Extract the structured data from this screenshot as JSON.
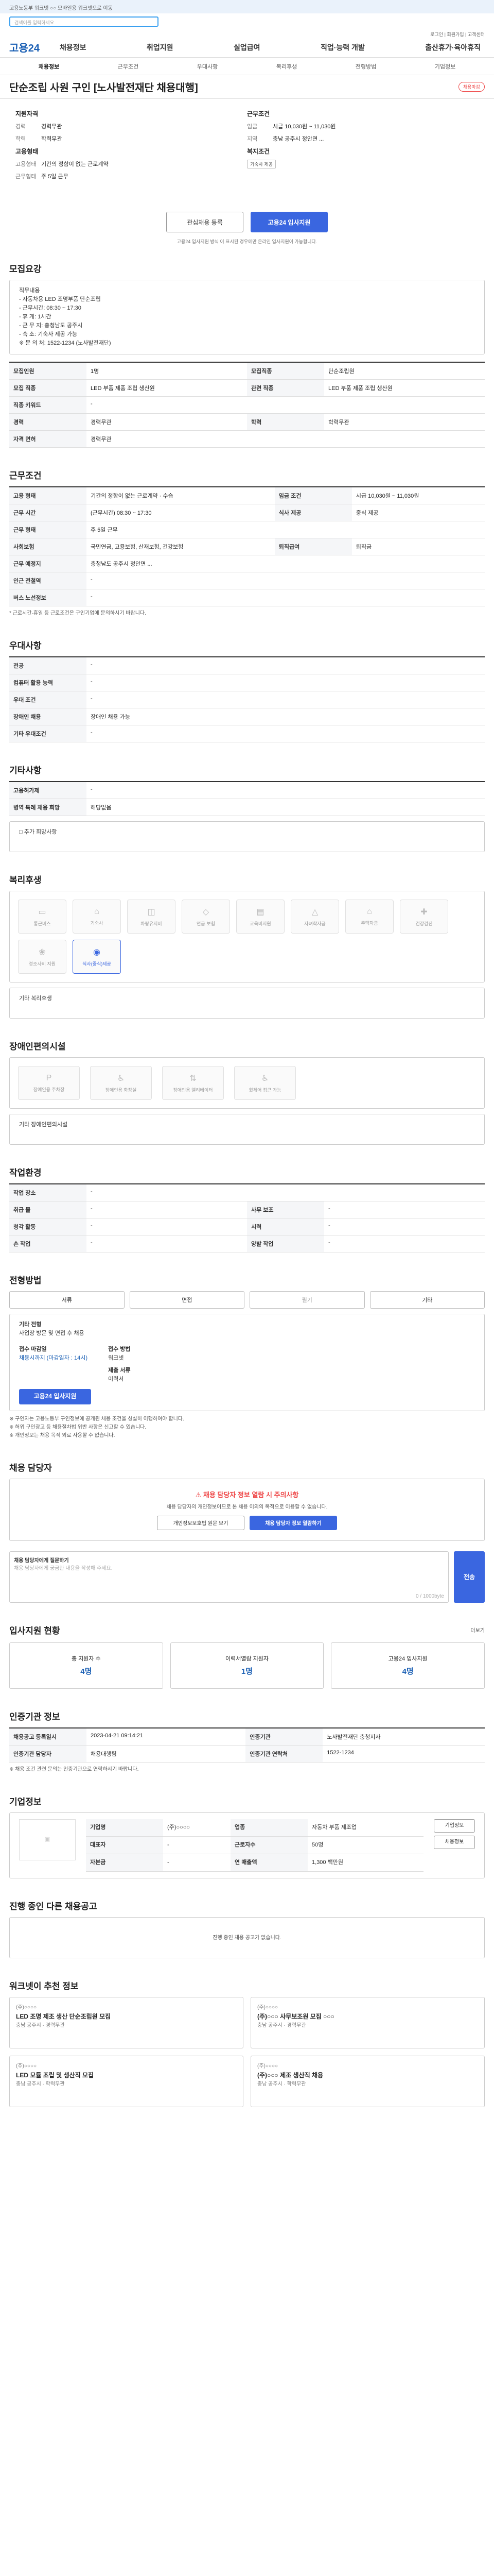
{
  "topbar": {
    "text": "고용노동부 워크넷 ○○ 모바일용 워크넷으로 이동"
  },
  "search": {
    "placeholder": "검색어를 입력하세요",
    "button": "검색"
  },
  "util": {
    "text": "로그인 | 회원가입 | 고객센터"
  },
  "header": {
    "logo": "고용24",
    "menu": [
      "채용정보",
      "취업지원",
      "실업급여",
      "직업·능력 개발",
      "출산휴가·육아휴직"
    ]
  },
  "tabs": [
    "채용정보",
    "근무조건",
    "우대사항",
    "복리후생",
    "전형방법",
    "기업정보"
  ],
  "title": {
    "text": "단순조립 사원 구인 [노사발전재단 채용대행]",
    "badge": "채용마감"
  },
  "summary": {
    "left_title": "지원자격",
    "left": [
      {
        "k": "경력",
        "v": "경력무관"
      },
      {
        "k": "학력",
        "v": "학력무관"
      }
    ],
    "left_title2": "고용형태",
    "left2": [
      {
        "k": "고용형태",
        "v": "기간의 정함이 없는 근로계약"
      },
      {
        "k": "근무형태",
        "v": "주 5일 근무"
      }
    ],
    "right_title": "근무조건",
    "right": [
      {
        "k": "임금",
        "v": "시급 10,030원 ~ 11,030원"
      },
      {
        "k": "지역",
        "v": "충남 공주시 정안면 ..."
      }
    ],
    "right_title2": "복지조건",
    "right2": "기숙사 제공"
  },
  "buttons": {
    "interest": "관심채용 등록",
    "apply": "고용24 입사지원"
  },
  "apply_note": "고용24 입사지원 방식 이 표시된 경우에만 온라인 입사지원이 가능합니다.",
  "s1": {
    "title": "모집요강",
    "box": [
      "직무내용",
      "- 자동차용 LED 조명부품 단순조립",
      "- 근무시간: 08:30 ~ 17:30",
      "- 휴 게: 1시간",
      "- 근 무 지: 충청남도 공주시",
      "- 숙 소: 기숙사 제공 가능",
      "",
      "※ 문 의 처: 1522-1234 (노사발전재단)"
    ],
    "rows": [
      [
        "모집인원",
        "1명",
        "모집직종",
        "단순조립원"
      ],
      [
        "모집 직종",
        "LED 부품 제품 조립 생산원",
        "관련 직종",
        "LED 부품 제품 조립 생산원"
      ],
      [
        "직종 키워드",
        "-",
        "",
        ""
      ],
      [
        "경력",
        "경력무관",
        "학력",
        "학력무관"
      ],
      [
        "자격 면허",
        "경력무관",
        "",
        ""
      ]
    ]
  },
  "s2": {
    "title": "근무조건",
    "rows": [
      [
        "고용 형태",
        "기간의 정함이 없는 근로계약 · 수습",
        "임금 조건",
        "시급 10,030원 ~ 11,030원"
      ],
      [
        "근무 시간",
        "(근무시간) 08:30 ~ 17:30",
        "식사 제공",
        "중식 제공"
      ],
      [
        "근무 형태",
        "주 5일 근무",
        "",
        ""
      ],
      [
        "사회보험",
        "국민연금, 고용보험, 산재보험, 건강보험",
        "퇴직급여",
        "퇴직금"
      ],
      [
        "근무 예정지",
        "충청남도 공주시 정안면 ...",
        "",
        ""
      ],
      [
        "인근 전철역",
        "-",
        "",
        ""
      ],
      [
        "버스 노선정보",
        "-",
        "",
        ""
      ]
    ],
    "note": "* 근로시간·휴일 등 근로조건은 구인기업에 문의하시기 바랍니다."
  },
  "s3": {
    "title": "우대사항",
    "rows": [
      [
        "전공",
        "-"
      ],
      [
        "컴퓨터 활용 능력",
        "-"
      ],
      [
        "우대 조건",
        "-"
      ],
      [
        "장애인 채용",
        "장애인 채용 가능"
      ],
      [
        "기타 우대조건",
        "-"
      ]
    ]
  },
  "s4": {
    "title": "기타사항",
    "rows": [
      [
        "고용허가제",
        "-"
      ],
      [
        "병역 특례 채용 희망",
        "해당없음"
      ]
    ],
    "box": "□ 추가 희망사항"
  },
  "s5": {
    "title": "복리후생",
    "items": [
      "통근버스",
      "기숙사",
      "차량유지비",
      "연금·보험",
      "교육비지원",
      "자녀학자금",
      "주택자금",
      "건강검진",
      "경조사비 지원",
      "식사(중식)제공"
    ],
    "other": "기타 복리후생"
  },
  "s6": {
    "title": "장애인편의시설",
    "items": [
      "장애인용 주차장",
      "장애인용 화장실",
      "장애인용 엘리베이터",
      "휠체어 접근 가능"
    ],
    "other": "기타 장애인편의시설"
  },
  "s7": {
    "title": "작업환경",
    "rows": [
      [
        "작업 장소",
        "-",
        "",
        ""
      ],
      [
        "취급 물",
        "-",
        "사무 보조",
        "-"
      ],
      [
        "청각 활동",
        "-",
        "시력",
        "-"
      ],
      [
        "손 작업",
        "-",
        "양발 작업",
        "-"
      ]
    ]
  },
  "s8": {
    "title": "전형방법",
    "choices": [
      "서류",
      "면접",
      "필기",
      "기타"
    ],
    "other_label": "기타 전형",
    "other": "사업장 방문 및 면접 후 채용",
    "deadline_label": "접수 마감일",
    "deadline": "채용시까지 (마감일자 : 14시)",
    "method_label": "접수 방법",
    "method": "워크넷",
    "docs_label": "제출 서류",
    "docs": "이력서",
    "apply": "고용24 입사지원",
    "notes": [
      "※ 구인자는 고용노동부 구인정보에 공개된 채용 조건을 성실히 이행하여야 합니다.",
      "※ 허위 구인광고 등 채용절차법 위반 사항은 신고할 수 있습니다.",
      "※ 개인정보는 채용 목적 외로 사용할 수 없습니다."
    ]
  },
  "s9": {
    "title": "채용 담당자",
    "alert": "채용 담당자 정보 열람 시 주의사항",
    "alert_text": "채용 담당자의 개인정보이므로 본 채용 이외의 목적으로 이용할 수 없습니다.",
    "btn1": "개인정보보호법 원문 보기",
    "btn2": "채용 담당자 정보 열람하기",
    "msg_label": "채용 담당자에게 질문하기",
    "msg_placeholder": "채용 담당자에게 궁금한 내용을 작성해 주세요.",
    "msg_count": "0 / 1000byte",
    "send": "전송"
  },
  "s10": {
    "title": "입사지원 현황",
    "more": "더보기",
    "stats": [
      [
        "총 지원자 수",
        "4명"
      ],
      [
        "이력서열람 지원자",
        "1명"
      ],
      [
        "고용24 입사지원",
        "4명"
      ]
    ]
  },
  "s11": {
    "title": "인증기관 정보",
    "rows": [
      [
        "채용공고 등록일시",
        "2023-04-21 09:14:21",
        "인증기관",
        "노사발전재단 충청지사"
      ],
      [
        "인증기관 담당자",
        "채용대행팀",
        "인증기관 연락처",
        "1522-1234"
      ]
    ],
    "notes": [
      "※ 채용 조건 관련 문의는 인증기관으로 연락하시기 바랍니다."
    ]
  },
  "s12": {
    "title": "기업정보",
    "rows": [
      [
        "기업명",
        "(주)○○○○",
        "업종",
        "자동차 부품 제조업"
      ],
      [
        "대표자",
        "-",
        "근로자수",
        "50명"
      ],
      [
        "자본금",
        "-",
        "연 매출액",
        "1,300 백만원"
      ],
      [
        "홈페이지",
        "-",
        "",
        ""
      ]
    ],
    "btn1": "기업정보",
    "btn2": "채용정보"
  },
  "s13": {
    "title": "진행 중인 다른 채용공고",
    "empty": "진행 중인 채용 공고가 없습니다."
  },
  "s14": {
    "title": "워크넷이 추천 정보",
    "cards": [
      {
        "c": "(주)○○○○",
        "t": "LED 조명 제조 생산 단순조립원 모집",
        "m": "충남 공주시 · 경력무관"
      },
      {
        "c": "(주)○○○○",
        "t": "(주)○○○ 사무보조원 모집 ○○○",
        "m": "충남 공주시 · 경력무관"
      },
      {
        "c": "(주)○○○○",
        "t": "LED 모듈 조립 및 생산직 모집",
        "m": "충남 공주시 · 학력무관"
      },
      {
        "c": "(주)○○○○",
        "t": "(주)○○○ 제조 생산직 채용",
        "m": "충남 공주시 · 학력무관"
      }
    ]
  }
}
